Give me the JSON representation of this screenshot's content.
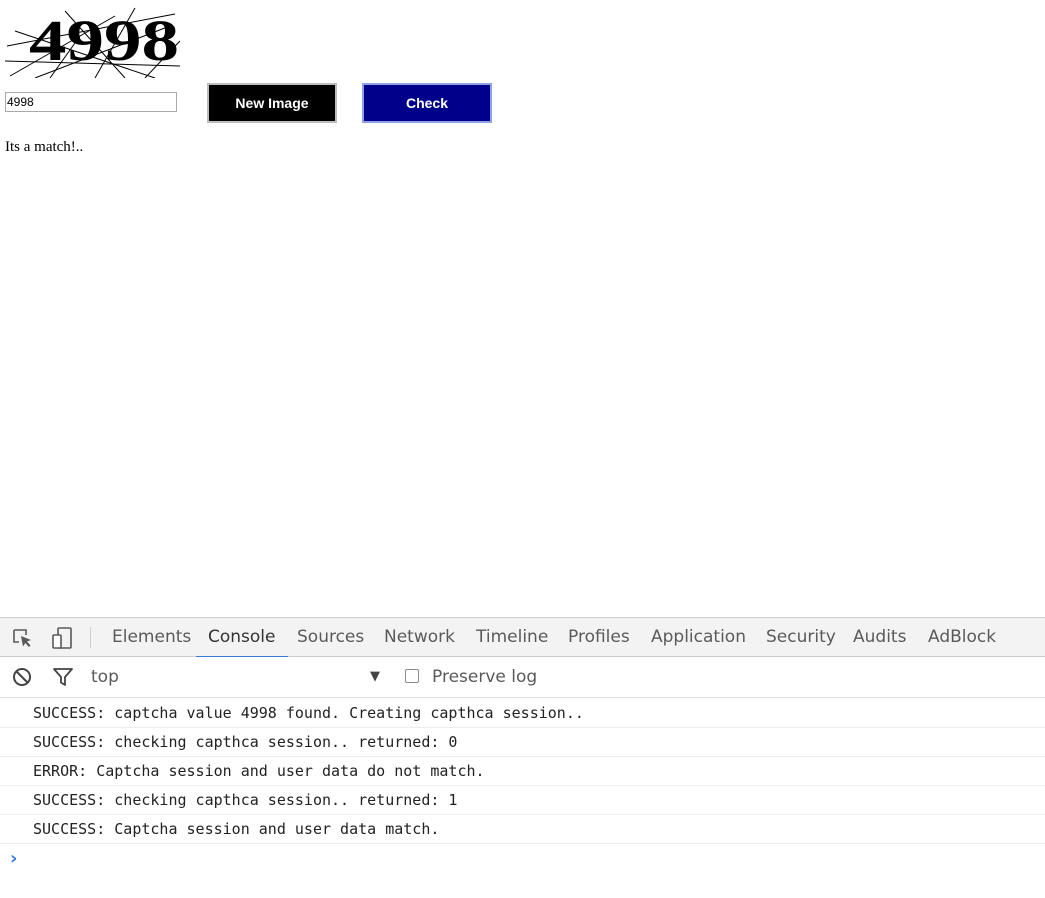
{
  "captcha": {
    "text": "4998"
  },
  "form": {
    "input_value": "4998",
    "new_image_label": "New Image",
    "check_label": "Check"
  },
  "result_text": "Its a match!..",
  "devtools": {
    "tabs": [
      {
        "label": "Elements"
      },
      {
        "label": "Console",
        "active": true
      },
      {
        "label": "Sources"
      },
      {
        "label": "Network"
      },
      {
        "label": "Timeline"
      },
      {
        "label": "Profiles"
      },
      {
        "label": "Application"
      },
      {
        "label": "Security"
      },
      {
        "label": "Audits"
      },
      {
        "label": "AdBlock"
      }
    ],
    "context": "top",
    "preserve_log_label": "Preserve log",
    "preserve_log_checked": false,
    "logs": [
      "SUCCESS: captcha value 4998 found. Creating capthca session..",
      "SUCCESS: checking capthca session.. returned: 0",
      "ERROR: Captcha session and user data do not match.",
      "SUCCESS: checking capthca session.. returned: 1",
      "SUCCESS: Captcha session and user data match."
    ],
    "prompt_symbol": "›"
  },
  "colors": {
    "new_image_bg": "#000000",
    "check_bg": "#00008b",
    "active_tab_underline": "#3879d9"
  },
  "icons": [
    "inspect-element-icon",
    "device-toolbar-icon",
    "clear-console-icon",
    "filter-icon",
    "dropdown-arrow-icon",
    "console-prompt-icon"
  ]
}
